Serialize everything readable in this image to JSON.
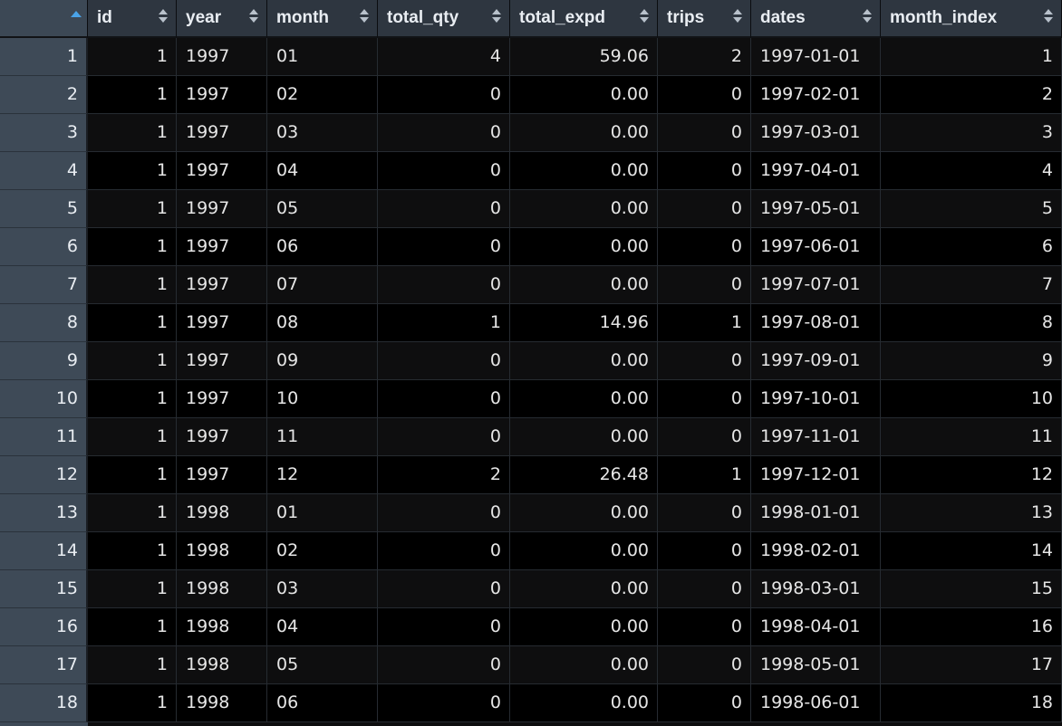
{
  "table": {
    "columns": [
      {
        "key": "id",
        "label": "id",
        "align": "num"
      },
      {
        "key": "year",
        "label": "year",
        "align": "txt"
      },
      {
        "key": "month",
        "label": "month",
        "align": "txt"
      },
      {
        "key": "total_qty",
        "label": "total_qty",
        "align": "num"
      },
      {
        "key": "total_expd",
        "label": "total_expd",
        "align": "num"
      },
      {
        "key": "trips",
        "label": "trips",
        "align": "num"
      },
      {
        "key": "dates",
        "label": "dates",
        "align": "txt"
      },
      {
        "key": "month_index",
        "label": "month_index",
        "align": "num"
      }
    ],
    "rows": [
      {
        "rownum": "1",
        "cells": [
          "1",
          "1997",
          "01",
          "4",
          "59.06",
          "2",
          "1997-01-01",
          "1"
        ]
      },
      {
        "rownum": "2",
        "cells": [
          "1",
          "1997",
          "02",
          "0",
          "0.00",
          "0",
          "1997-02-01",
          "2"
        ]
      },
      {
        "rownum": "3",
        "cells": [
          "1",
          "1997",
          "03",
          "0",
          "0.00",
          "0",
          "1997-03-01",
          "3"
        ]
      },
      {
        "rownum": "4",
        "cells": [
          "1",
          "1997",
          "04",
          "0",
          "0.00",
          "0",
          "1997-04-01",
          "4"
        ]
      },
      {
        "rownum": "5",
        "cells": [
          "1",
          "1997",
          "05",
          "0",
          "0.00",
          "0",
          "1997-05-01",
          "5"
        ]
      },
      {
        "rownum": "6",
        "cells": [
          "1",
          "1997",
          "06",
          "0",
          "0.00",
          "0",
          "1997-06-01",
          "6"
        ]
      },
      {
        "rownum": "7",
        "cells": [
          "1",
          "1997",
          "07",
          "0",
          "0.00",
          "0",
          "1997-07-01",
          "7"
        ]
      },
      {
        "rownum": "8",
        "cells": [
          "1",
          "1997",
          "08",
          "1",
          "14.96",
          "1",
          "1997-08-01",
          "8"
        ]
      },
      {
        "rownum": "9",
        "cells": [
          "1",
          "1997",
          "09",
          "0",
          "0.00",
          "0",
          "1997-09-01",
          "9"
        ]
      },
      {
        "rownum": "10",
        "cells": [
          "1",
          "1997",
          "10",
          "0",
          "0.00",
          "0",
          "1997-10-01",
          "10"
        ]
      },
      {
        "rownum": "11",
        "cells": [
          "1",
          "1997",
          "11",
          "0",
          "0.00",
          "0",
          "1997-11-01",
          "11"
        ]
      },
      {
        "rownum": "12",
        "cells": [
          "1",
          "1997",
          "12",
          "2",
          "26.48",
          "1",
          "1997-12-01",
          "12"
        ]
      },
      {
        "rownum": "13",
        "cells": [
          "1",
          "1998",
          "01",
          "0",
          "0.00",
          "0",
          "1998-01-01",
          "13"
        ]
      },
      {
        "rownum": "14",
        "cells": [
          "1",
          "1998",
          "02",
          "0",
          "0.00",
          "0",
          "1998-02-01",
          "14"
        ]
      },
      {
        "rownum": "15",
        "cells": [
          "1",
          "1998",
          "03",
          "0",
          "0.00",
          "0",
          "1998-03-01",
          "15"
        ]
      },
      {
        "rownum": "16",
        "cells": [
          "1",
          "1998",
          "04",
          "0",
          "0.00",
          "0",
          "1998-04-01",
          "16"
        ]
      },
      {
        "rownum": "17",
        "cells": [
          "1",
          "1998",
          "05",
          "0",
          "0.00",
          "0",
          "1998-05-01",
          "17"
        ]
      },
      {
        "rownum": "18",
        "cells": [
          "1",
          "1998",
          "06",
          "0",
          "0.00",
          "0",
          "1998-06-01",
          "18"
        ]
      }
    ]
  },
  "colors": {
    "header_bg": "#2e3640",
    "rownum_bg": "#3e4a57",
    "sort_active": "#4aa3e8",
    "row_odd": "#0e0e0f",
    "row_even": "#000000"
  }
}
